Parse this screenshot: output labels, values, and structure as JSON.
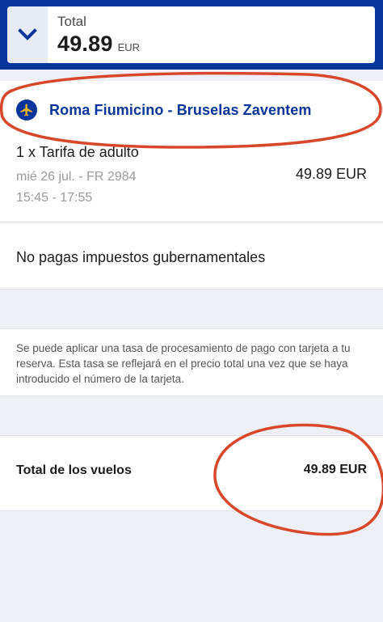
{
  "summary": {
    "total_label": "Total",
    "total_amount": "49.89",
    "total_currency": "EUR"
  },
  "flight": {
    "route": "Roma Fiumicino - Bruselas Zaventem",
    "fare": "1 x Tarifa de adulto",
    "date_flight": "mié 26 jul. - FR 2984",
    "time": "15:45 - 17:55",
    "price": "49.89 EUR"
  },
  "taxes_text": "No pagas impuestos gubernamentales",
  "payment_note": "Se puede aplicar una tasa de procesamiento de pago con tarjeta a tu reserva. Esta tasa se reflejará en el precio total una vez que se haya introducido el número de la tarjeta.",
  "flights_total": {
    "label": "Total de los vuelos",
    "value": "49.89 EUR"
  },
  "colors": {
    "brand": "#07359c",
    "annotation": "#d9472b"
  },
  "icons": [
    "chevron-down-icon",
    "plane-icon"
  ]
}
